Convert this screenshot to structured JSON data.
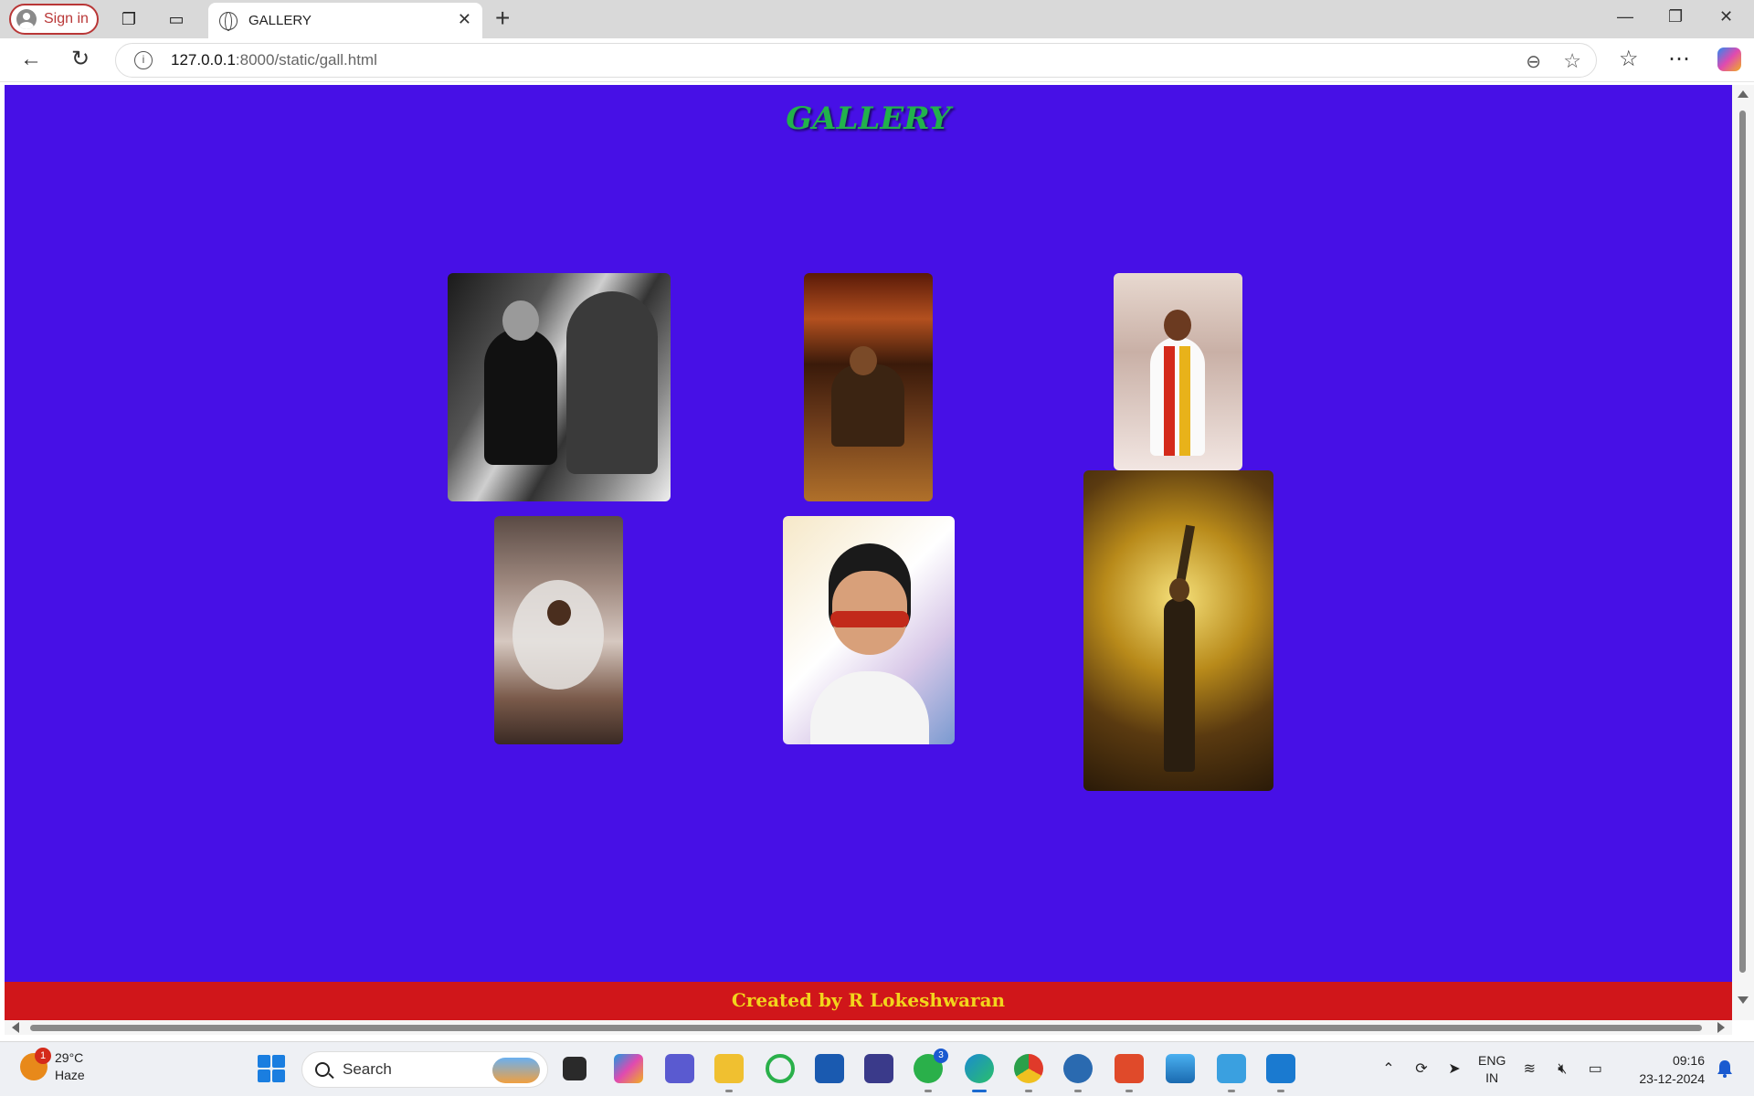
{
  "browser": {
    "signin_label": "Sign in",
    "tab_title": "GALLERY",
    "url_host": "127.0.0.1",
    "url_path": ":8000/static/gall.html"
  },
  "page": {
    "title": "GALLERY",
    "footer": "Created by R Lokeshwaran",
    "background_color": "#4710e6",
    "title_color": "#22b24c",
    "footer_color": "#d0161a",
    "footer_text_color": "#f2d51c",
    "photos": [
      {
        "name": "photo-1",
        "description": "black and white seated portrait"
      },
      {
        "name": "photo-2",
        "description": "man seated in leather armchair"
      },
      {
        "name": "photo-3",
        "description": "man dancing with red and yellow scarf"
      },
      {
        "name": "photo-4",
        "description": "man in smoke in corridor"
      },
      {
        "name": "photo-5",
        "description": "smiling man with sunglasses painting"
      },
      {
        "name": "photo-6",
        "description": "man raising arm amid golden fire"
      }
    ]
  },
  "taskbar": {
    "temperature": "29°C",
    "weather": "Haze",
    "weather_badge": "1",
    "search_placeholder": "Search",
    "lang_line1": "ENG",
    "lang_line2": "IN",
    "time": "09:16",
    "date": "23-12-2024"
  }
}
